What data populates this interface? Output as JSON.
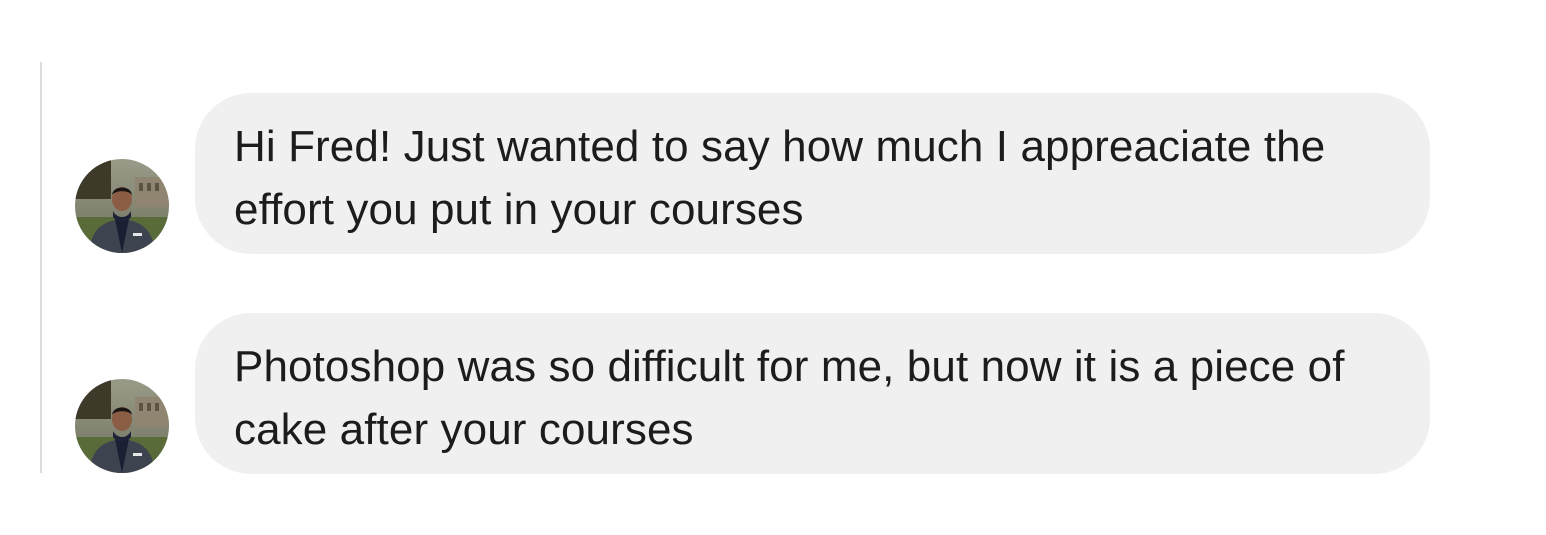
{
  "conversation": {
    "messages": [
      {
        "avatar_icon": "user-profile-photo",
        "text": "Hi Fred! Just wanted to say how much I appreaciate the effort you put in your courses"
      },
      {
        "avatar_icon": "user-profile-photo",
        "text": "Photoshop was so difficult for me, but now it is a piece of cake after your courses"
      }
    ]
  },
  "colors": {
    "bubble_background": "#f0f0f0",
    "text": "#1c1c1c",
    "thread_rule": "#dcdcdc",
    "page_background": "#ffffff"
  }
}
